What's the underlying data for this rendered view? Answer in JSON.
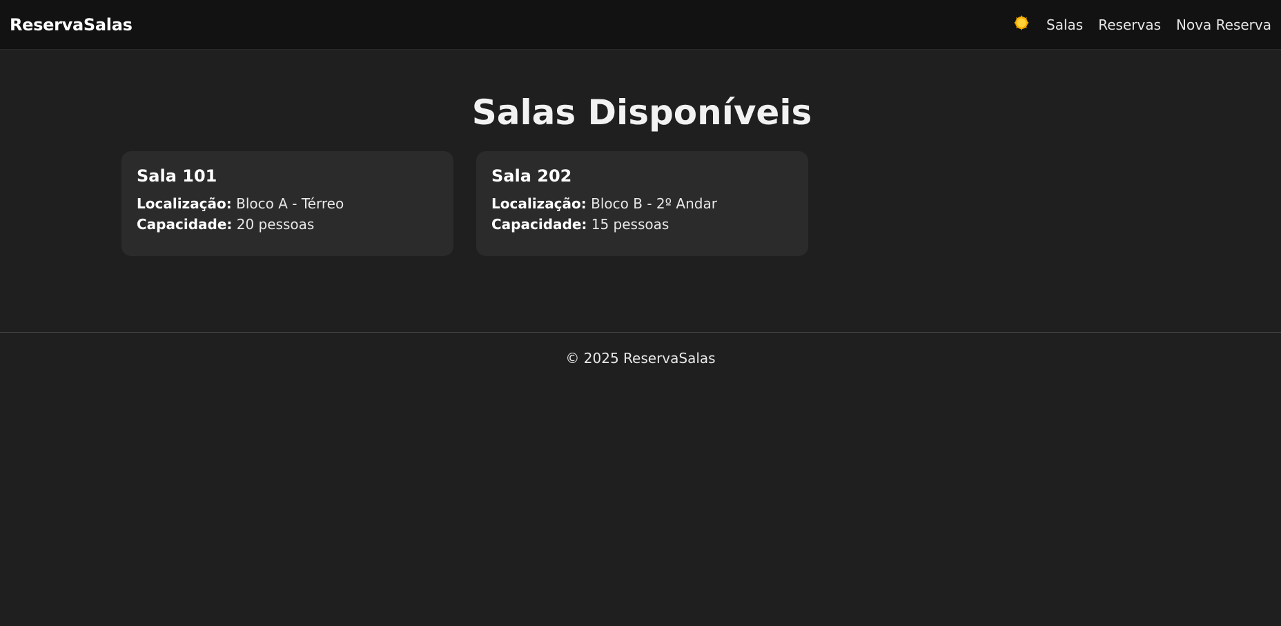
{
  "navbar": {
    "brand": "ReservaSalas",
    "theme_icon": "sun-icon",
    "links": [
      "Salas",
      "Reservas",
      "Nova Reserva"
    ]
  },
  "main": {
    "title": "Salas Disponíveis",
    "rooms": [
      {
        "name": "Sala 101",
        "location_label": "Localização:",
        "location": "Bloco A - Térreo",
        "capacity_label": "Capacidade:",
        "capacity": "20 pessoas"
      },
      {
        "name": "Sala 202",
        "location_label": "Localização:",
        "location": "Bloco B - 2º Andar",
        "capacity_label": "Capacidade:",
        "capacity": "15 pessoas"
      }
    ]
  },
  "footer": {
    "text": "© 2025 ReservaSalas"
  },
  "colors": {
    "background": "#1f1f1f",
    "navbar": "#121212",
    "card": "#2b2b2b",
    "sun": "#f5b800"
  }
}
